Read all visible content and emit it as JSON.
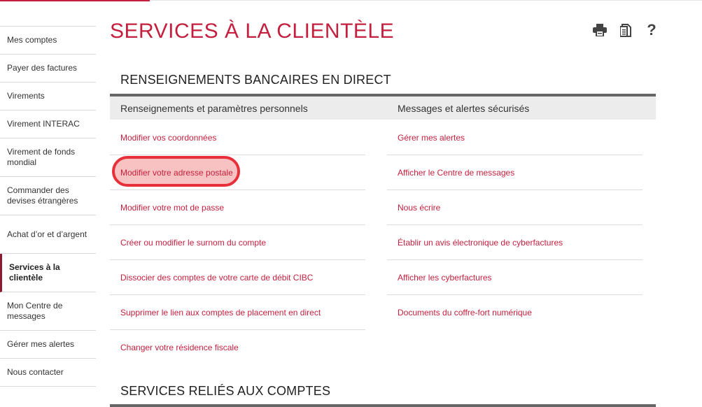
{
  "sidebar": {
    "items": [
      {
        "label": "Mes comptes"
      },
      {
        "label": "Payer des factures"
      },
      {
        "label": "Virements"
      },
      {
        "label": "Virement INTERAC"
      },
      {
        "label": "Virement de fonds mondial"
      },
      {
        "label": "Commander des devises étrangères"
      },
      {
        "label": "Achat d’or et d’argent"
      },
      {
        "label": "Services à la clientèle"
      },
      {
        "label": "Mon Centre de messages"
      },
      {
        "label": "Gérer mes alertes"
      },
      {
        "label": "Nous contacter"
      }
    ]
  },
  "page": {
    "title": "SERVICES À LA CLIENTÈLE"
  },
  "tools": {
    "print_icon": "printer-icon",
    "document_icon": "document-icon",
    "help_label": "?"
  },
  "sections": {
    "banking": {
      "title": "RENSEIGNEMENTS BANCAIRES EN DIRECT",
      "left_header": "Renseignements et paramètres personnels",
      "right_header": "Messages et alertes sécurisés",
      "left_links": [
        "Modifier vos coordonnées",
        "Modifier votre adresse postale",
        "Modifier votre mot de passe",
        "Créer ou modifier le surnom du compte",
        "Dissocier des comptes de votre carte de débit CIBC",
        "Supprimer le lien aux comptes de placement en direct",
        "Changer votre résidence fiscale"
      ],
      "right_links": [
        "Gérer mes alertes",
        "Afficher le Centre de messages",
        "Nous écrire",
        "Établir un avis électronique de cyberfactures",
        "Afficher les cyberfactures",
        "Documents du coffre-fort numérique"
      ]
    },
    "accounts": {
      "title": "SERVICES RELIÉS AUX COMPTES"
    }
  },
  "colors": {
    "brand_red": "#c41f3e",
    "highlight_ring": "#e8303a",
    "active_marker": "#8b1a32"
  }
}
